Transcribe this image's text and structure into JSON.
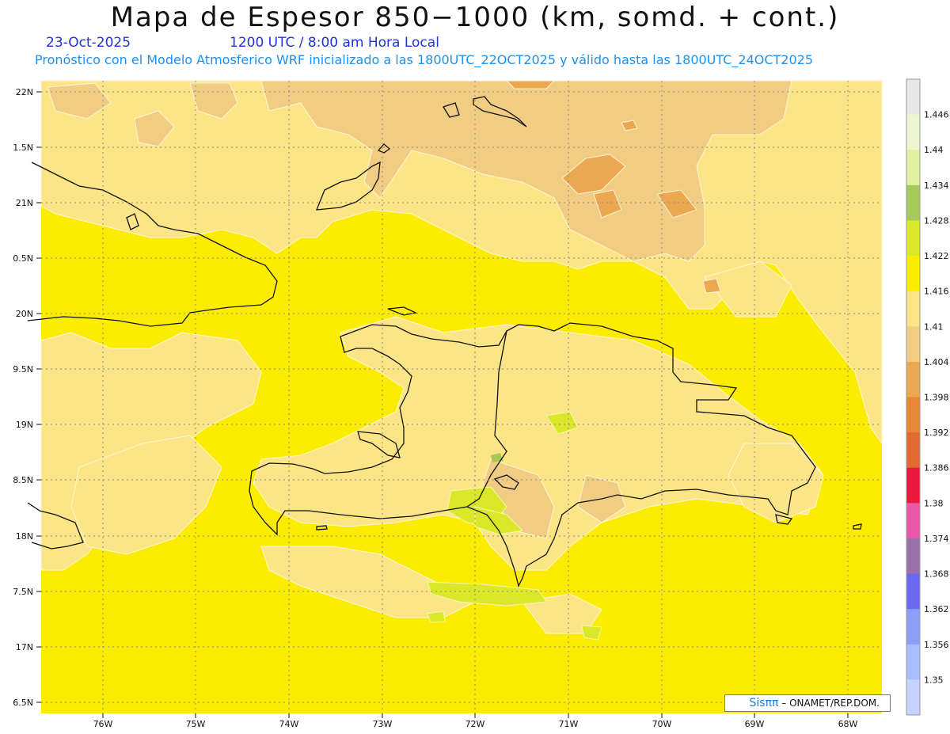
{
  "header": {
    "title": "Mapa de Espesor 850−1000 (km, somd. + cont.)",
    "date": "23-Oct-2025",
    "time": "1200 UTC / 8:00 am Hora Local",
    "model_info": "Pronóstico con el Modelo Atmosferico WRF inicializado a las 1800UTC_22OCT2025 y válido hasta las  1800UTC_24OCT2025"
  },
  "map": {
    "lat_labels": [
      "22N",
      "1.5N",
      "21N",
      "0.5N",
      "20N",
      "9.5N",
      "19N",
      "8.5N",
      "18N",
      "7.5N",
      "17N",
      "6.5N"
    ],
    "lon_labels": [
      "76W",
      "75W",
      "74W",
      "73W",
      "72W",
      "71W",
      "70W",
      "69W",
      "68W"
    ],
    "background_color": "#fced00"
  },
  "colorbar": {
    "labels": [
      "1.446",
      "1.44",
      "1.434",
      "1.428",
      "1.422",
      "1.416",
      "1.41",
      "1.404",
      "1.398",
      "1.392",
      "1.386",
      "1.38",
      "1.374",
      "1.368",
      "1.362",
      "1.356",
      "1.35"
    ],
    "colors": [
      "#e8e8e8",
      "#eef6cf",
      "#e2f0a4",
      "#a7c95a",
      "#dbe82a",
      "#fced00",
      "#fbe586",
      "#f0cd82",
      "#eca850",
      "#e88835",
      "#e06a30",
      "#e8193c",
      "#ea58a8",
      "#9a70a8",
      "#6868f0",
      "#8aa0f8",
      "#a8beff",
      "#c4d4ff"
    ]
  },
  "credit": {
    "sis": "Sis",
    "pi": "ππ",
    "rest": " – ONAMET/REP.DOM."
  }
}
